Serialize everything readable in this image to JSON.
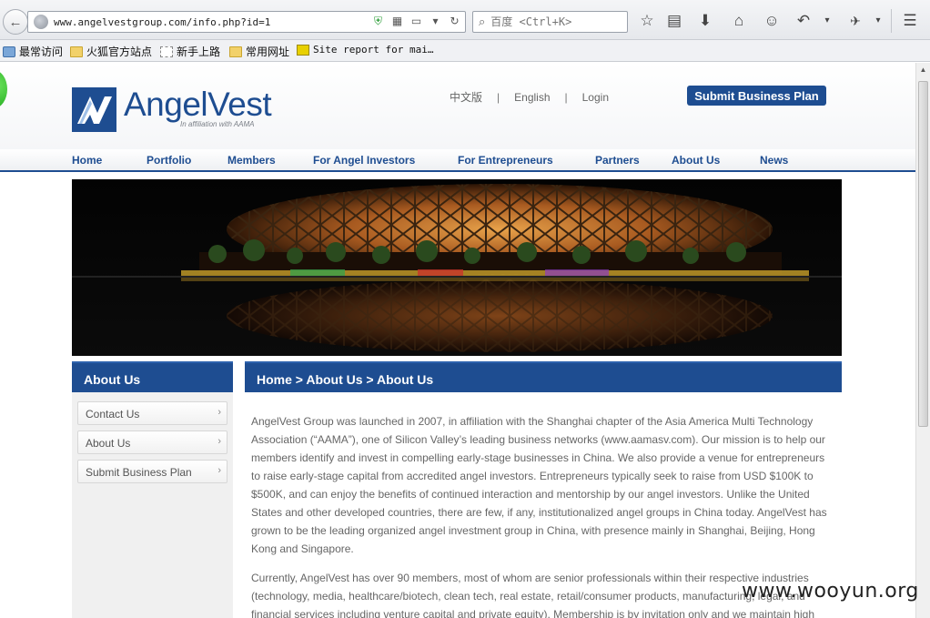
{
  "browser": {
    "url": "www.angelvestgroup.com/info.php?id=1",
    "search_placeholder": "百度 <Ctrl+K>"
  },
  "bookmarks": [
    {
      "label": "最常访问"
    },
    {
      "label": "火狐官方站点"
    },
    {
      "label": "新手上路"
    },
    {
      "label": "常用网址"
    },
    {
      "label": "Site report for mai…"
    }
  ],
  "site": {
    "logo_name": "AngelVest",
    "logo_tagline": "In affiliation with AAMA",
    "lang_cn": "中文版",
    "lang_en": "English",
    "login": "Login",
    "submit_label": "Submit Business Plan"
  },
  "nav": [
    {
      "label": "Home"
    },
    {
      "label": "Portfolio"
    },
    {
      "label": "Members"
    },
    {
      "label": "For Angel Investors"
    },
    {
      "label": "For Entrepreneurs"
    },
    {
      "label": "Partners"
    },
    {
      "label": "About Us"
    },
    {
      "label": "News"
    }
  ],
  "sidebar": {
    "title": "About Us",
    "items": [
      {
        "label": "Contact Us"
      },
      {
        "label": "About Us"
      },
      {
        "label": "Submit Business Plan"
      }
    ]
  },
  "breadcrumb": "Home > About Us > About Us",
  "content": {
    "p1": "AngelVest Group was launched in 2007, in affiliation with the Shanghai chapter of the Asia America Multi Technology Association (“AAMA”), one of Silicon Valley’s leading business networks (www.aamasv.com). Our mission is to help our members identify and invest in compelling early-stage businesses in China. We also provide a venue for entrepreneurs to raise early-stage capital from accredited angel investors.  Entrepreneurs typically seek to raise from USD $100K to $500K, and can enjoy the benefits of continued interaction and mentorship by our angel investors. Unlike the United States and other developed countries, there are few, if any, institutionalized angel groups in China today.  AngelVest has grown to be the leading organized angel investment group in China, with presence mainly in Shanghai, Beijing, Hong Kong and Singapore.",
    "p2": "Currently, AngelVest has over 90 members, most of whom are senior professionals within their respective industries (technology, media, healthcare/biotech, clean tech, real estate, retail/consumer products, manufacturing, legal, and financial services including venture capital and private equity).  Membership is by invitation only and we maintain high"
  },
  "watermark": "www.wooyun.org",
  "colors": {
    "brand_blue": "#1e4d91",
    "body_text": "#666666"
  }
}
